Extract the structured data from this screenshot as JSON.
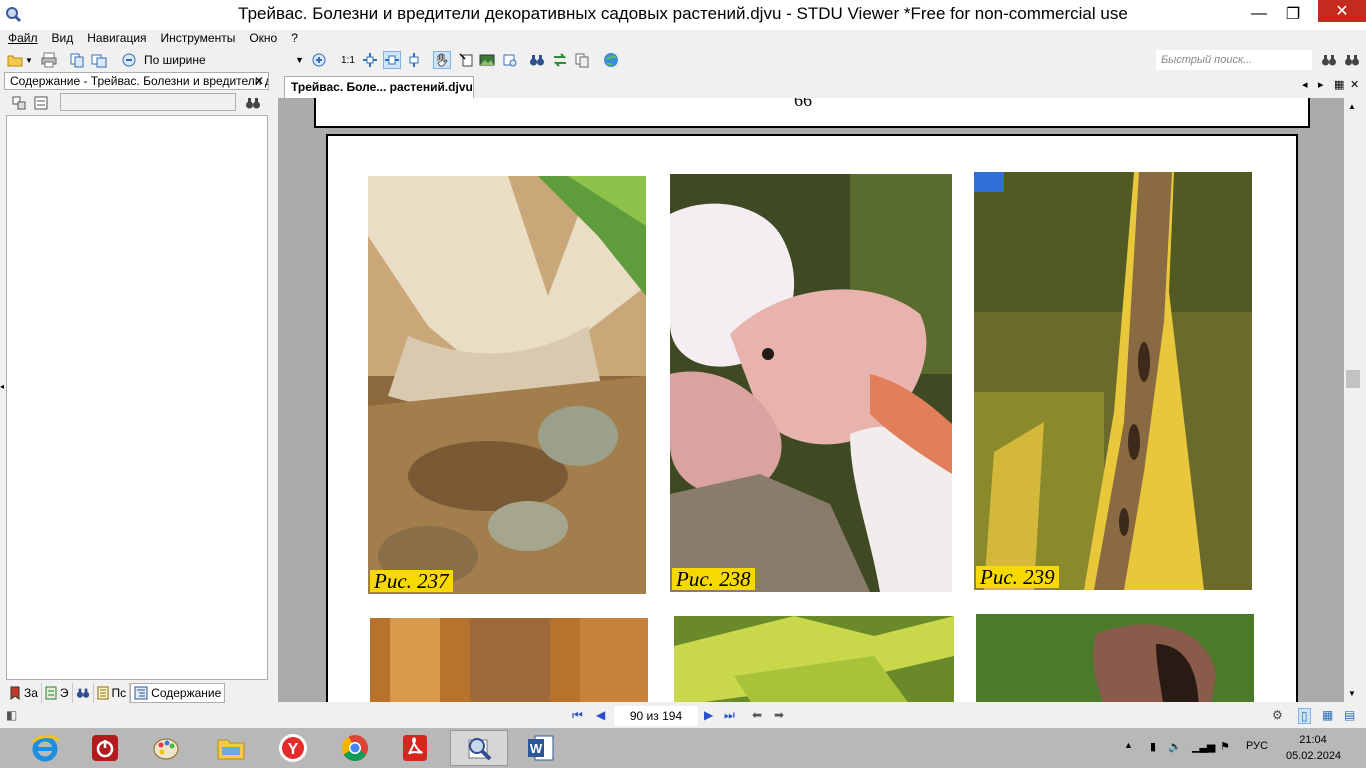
{
  "window": {
    "title": "Трейвас. Болезни и вредители декоративных садовых растений.djvu - STDU Viewer *Free for non-commercial use",
    "min_glyph": "—",
    "max_glyph": "❐",
    "close_glyph": "✕"
  },
  "menu": [
    "Файл",
    "Вид",
    "Навигация",
    "Инструменты",
    "Окно",
    "?"
  ],
  "toolbar": {
    "zoom_value": "По ширине",
    "actual_size_label": "1:1",
    "quick_search_placeholder": "Быстрый поиск..."
  },
  "left_panel": {
    "header": "Содержание - Трейвас. Болезни и вредители декоративных садовых растений.djvu",
    "close_glyph": "✕",
    "tabs": [
      {
        "label": "За",
        "icon": "bookmark-icon"
      },
      {
        "label": "Э",
        "icon": "thumbnails-icon"
      },
      {
        "label": "",
        "icon": "binoculars-icon"
      },
      {
        "label": "Пс",
        "icon": "search-results-icon"
      },
      {
        "label": "Содержание",
        "icon": "contents-icon"
      }
    ]
  },
  "document": {
    "tab_label": "Трейвас. Боле... растений.djvu",
    "prev_page_number": "66",
    "photos": [
      {
        "caption": "Рис. 237"
      },
      {
        "caption": "Рис. 238"
      },
      {
        "caption": "Рис. 239"
      }
    ]
  },
  "status": {
    "page_indicator": "90 из 194"
  },
  "taskbar": {
    "apps": [
      "internet-explorer-icon",
      "power-icon",
      "paint-icon",
      "file-explorer-icon",
      "yandex-browser-icon",
      "chrome-icon",
      "pdf-reader-icon",
      "stdu-viewer-icon",
      "word-icon"
    ],
    "language": "РУС",
    "time": "21:04",
    "date": "05.02.2024"
  },
  "colors": {
    "caption_bg": "#f7d900",
    "close_red": "#c42b1c",
    "viewer_bg": "#ababab"
  }
}
